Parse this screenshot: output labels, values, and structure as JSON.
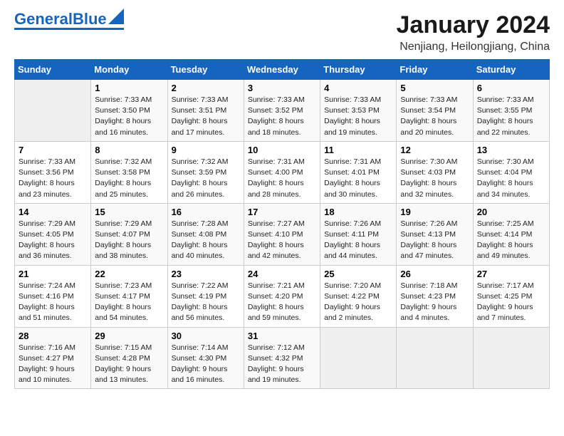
{
  "logo": {
    "text1": "General",
    "text2": "Blue"
  },
  "title": "January 2024",
  "location": "Nenjiang, Heilongjiang, China",
  "days_header": [
    "Sunday",
    "Monday",
    "Tuesday",
    "Wednesday",
    "Thursday",
    "Friday",
    "Saturday"
  ],
  "weeks": [
    [
      {
        "day": "",
        "info": ""
      },
      {
        "day": "1",
        "info": "Sunrise: 7:33 AM\nSunset: 3:50 PM\nDaylight: 8 hours\nand 16 minutes."
      },
      {
        "day": "2",
        "info": "Sunrise: 7:33 AM\nSunset: 3:51 PM\nDaylight: 8 hours\nand 17 minutes."
      },
      {
        "day": "3",
        "info": "Sunrise: 7:33 AM\nSunset: 3:52 PM\nDaylight: 8 hours\nand 18 minutes."
      },
      {
        "day": "4",
        "info": "Sunrise: 7:33 AM\nSunset: 3:53 PM\nDaylight: 8 hours\nand 19 minutes."
      },
      {
        "day": "5",
        "info": "Sunrise: 7:33 AM\nSunset: 3:54 PM\nDaylight: 8 hours\nand 20 minutes."
      },
      {
        "day": "6",
        "info": "Sunrise: 7:33 AM\nSunset: 3:55 PM\nDaylight: 8 hours\nand 22 minutes."
      }
    ],
    [
      {
        "day": "7",
        "info": "Sunrise: 7:33 AM\nSunset: 3:56 PM\nDaylight: 8 hours\nand 23 minutes."
      },
      {
        "day": "8",
        "info": "Sunrise: 7:32 AM\nSunset: 3:58 PM\nDaylight: 8 hours\nand 25 minutes."
      },
      {
        "day": "9",
        "info": "Sunrise: 7:32 AM\nSunset: 3:59 PM\nDaylight: 8 hours\nand 26 minutes."
      },
      {
        "day": "10",
        "info": "Sunrise: 7:31 AM\nSunset: 4:00 PM\nDaylight: 8 hours\nand 28 minutes."
      },
      {
        "day": "11",
        "info": "Sunrise: 7:31 AM\nSunset: 4:01 PM\nDaylight: 8 hours\nand 30 minutes."
      },
      {
        "day": "12",
        "info": "Sunrise: 7:30 AM\nSunset: 4:03 PM\nDaylight: 8 hours\nand 32 minutes."
      },
      {
        "day": "13",
        "info": "Sunrise: 7:30 AM\nSunset: 4:04 PM\nDaylight: 8 hours\nand 34 minutes."
      }
    ],
    [
      {
        "day": "14",
        "info": "Sunrise: 7:29 AM\nSunset: 4:05 PM\nDaylight: 8 hours\nand 36 minutes."
      },
      {
        "day": "15",
        "info": "Sunrise: 7:29 AM\nSunset: 4:07 PM\nDaylight: 8 hours\nand 38 minutes."
      },
      {
        "day": "16",
        "info": "Sunrise: 7:28 AM\nSunset: 4:08 PM\nDaylight: 8 hours\nand 40 minutes."
      },
      {
        "day": "17",
        "info": "Sunrise: 7:27 AM\nSunset: 4:10 PM\nDaylight: 8 hours\nand 42 minutes."
      },
      {
        "day": "18",
        "info": "Sunrise: 7:26 AM\nSunset: 4:11 PM\nDaylight: 8 hours\nand 44 minutes."
      },
      {
        "day": "19",
        "info": "Sunrise: 7:26 AM\nSunset: 4:13 PM\nDaylight: 8 hours\nand 47 minutes."
      },
      {
        "day": "20",
        "info": "Sunrise: 7:25 AM\nSunset: 4:14 PM\nDaylight: 8 hours\nand 49 minutes."
      }
    ],
    [
      {
        "day": "21",
        "info": "Sunrise: 7:24 AM\nSunset: 4:16 PM\nDaylight: 8 hours\nand 51 minutes."
      },
      {
        "day": "22",
        "info": "Sunrise: 7:23 AM\nSunset: 4:17 PM\nDaylight: 8 hours\nand 54 minutes."
      },
      {
        "day": "23",
        "info": "Sunrise: 7:22 AM\nSunset: 4:19 PM\nDaylight: 8 hours\nand 56 minutes."
      },
      {
        "day": "24",
        "info": "Sunrise: 7:21 AM\nSunset: 4:20 PM\nDaylight: 8 hours\nand 59 minutes."
      },
      {
        "day": "25",
        "info": "Sunrise: 7:20 AM\nSunset: 4:22 PM\nDaylight: 9 hours\nand 2 minutes."
      },
      {
        "day": "26",
        "info": "Sunrise: 7:18 AM\nSunset: 4:23 PM\nDaylight: 9 hours\nand 4 minutes."
      },
      {
        "day": "27",
        "info": "Sunrise: 7:17 AM\nSunset: 4:25 PM\nDaylight: 9 hours\nand 7 minutes."
      }
    ],
    [
      {
        "day": "28",
        "info": "Sunrise: 7:16 AM\nSunset: 4:27 PM\nDaylight: 9 hours\nand 10 minutes."
      },
      {
        "day": "29",
        "info": "Sunrise: 7:15 AM\nSunset: 4:28 PM\nDaylight: 9 hours\nand 13 minutes."
      },
      {
        "day": "30",
        "info": "Sunrise: 7:14 AM\nSunset: 4:30 PM\nDaylight: 9 hours\nand 16 minutes."
      },
      {
        "day": "31",
        "info": "Sunrise: 7:12 AM\nSunset: 4:32 PM\nDaylight: 9 hours\nand 19 minutes."
      },
      {
        "day": "",
        "info": ""
      },
      {
        "day": "",
        "info": ""
      },
      {
        "day": "",
        "info": ""
      }
    ]
  ]
}
